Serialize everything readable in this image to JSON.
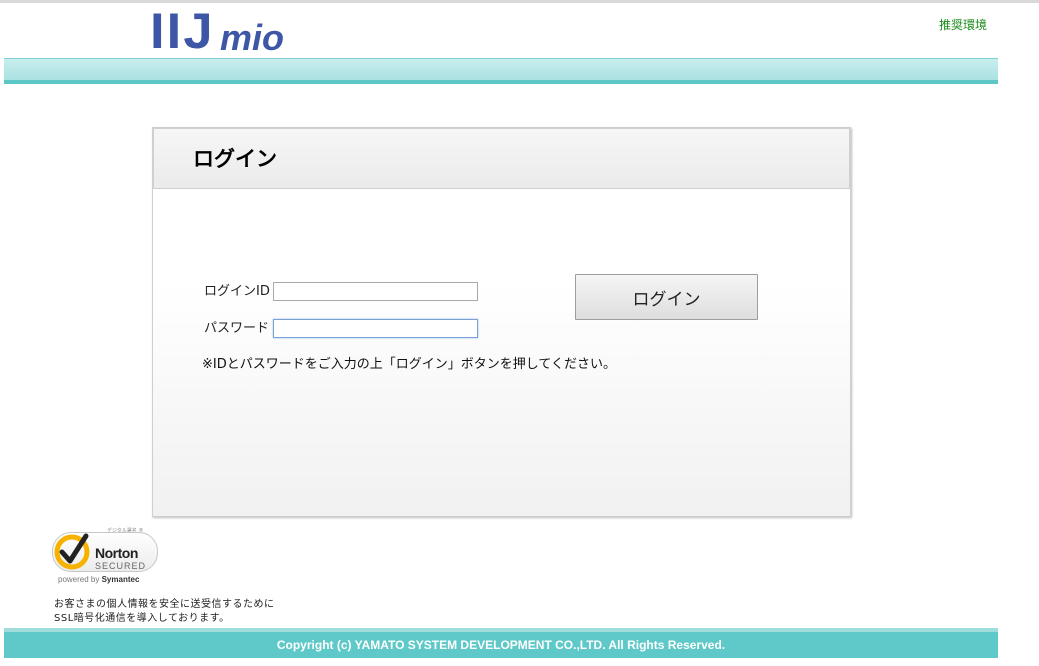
{
  "header": {
    "logo_text_main": "IIJ",
    "logo_text_sub": "mio",
    "recommended_env_link": "推奨環境"
  },
  "login_panel": {
    "title": "ログイン",
    "login_id_label": "ログインID",
    "login_id_value": "",
    "password_label": "パスワード",
    "password_value": "",
    "login_button": "ログイン",
    "note": "※IDとパスワードをご入力の上「ログイン」ボタンを押してください。"
  },
  "security": {
    "seal_top_text": "デジタル署名 ®",
    "seal_name": "Norton",
    "seal_secured": "SECURED",
    "seal_powered_prefix": "powered by ",
    "seal_powered_brand": "Symantec",
    "ssl_note_line1": "お客さまの個人情報を安全に送受信するために",
    "ssl_note_line2": "SSL暗号化通信を導入しております。"
  },
  "footer": {
    "copyright": "Copyright (c) YAMATO SYSTEM DEVELOPMENT CO.,LTD. All Rights Reserved."
  },
  "colors": {
    "brand_blue": "#3d56a6",
    "teal_band": "#5ec9c8",
    "link_green": "#1a8a1a"
  }
}
